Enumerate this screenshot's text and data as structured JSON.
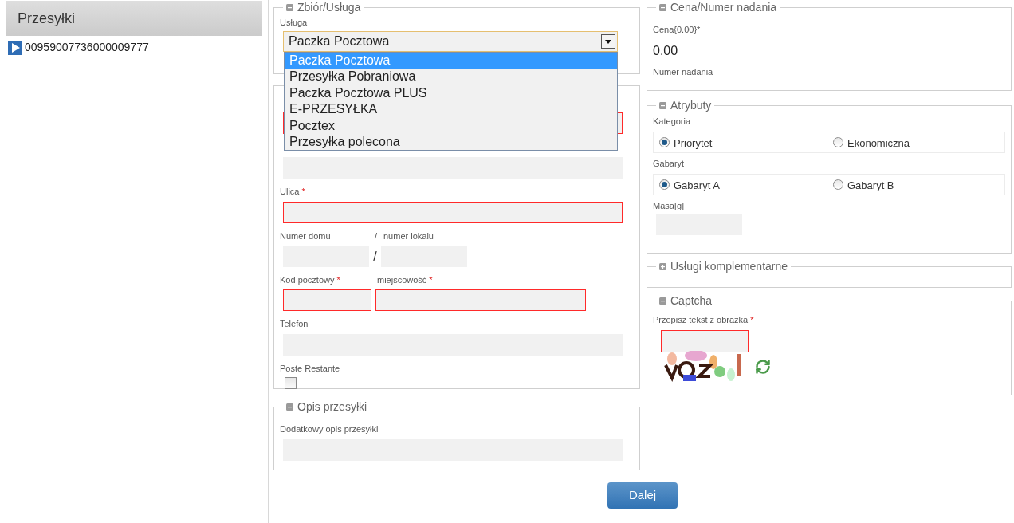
{
  "sidebar": {
    "title": "Przesyłki",
    "items": [
      {
        "label": "00959007736000009777"
      }
    ]
  },
  "service_section": {
    "title": "Zbiór/Usługa",
    "expanded": true,
    "label": "Usługa",
    "value": "Paczka Pocztowa",
    "open": true,
    "options": [
      {
        "label": "Paczka Pocztowa",
        "selected": true
      },
      {
        "label": "Przesyłka Pobraniowa",
        "selected": false
      },
      {
        "label": "Paczka Pocztowa PLUS",
        "selected": false
      },
      {
        "label": "E-PRZESYŁKA",
        "selected": false
      },
      {
        "label": "Pocztex",
        "selected": false
      },
      {
        "label": "Przesyłka polecona",
        "selected": false
      }
    ]
  },
  "address_section": {
    "rows": [
      {
        "kind": "field",
        "invalid": true
      },
      {
        "kind": "field",
        "invalid": false
      },
      {
        "kind": "field",
        "label": "Ulica",
        "required_mark": "*",
        "invalid": true
      },
      {
        "kind": "house_number",
        "label": "Numer domu",
        "label_separator": "/",
        "field_separator": "/",
        "fields": [
          {
            "label": "numer lokalu",
            "invalid": false
          }
        ]
      },
      {
        "kind": "postal_city",
        "fields": [
          {
            "label": "Kod pocztowy",
            "required_mark": "*",
            "invalid": true
          },
          {
            "label": "miejscowość",
            "required_mark": "*",
            "invalid": true
          }
        ]
      },
      {
        "kind": "field",
        "label": "Telefon",
        "invalid": false
      },
      {
        "kind": "checkbox",
        "label": "Poste Restante",
        "checked": false
      }
    ]
  },
  "description_section": {
    "title": "Opis przesyłki",
    "expanded": true,
    "label": "Dodatkowy opis przesyłki"
  },
  "price_section": {
    "title": "Cena/Numer nadania",
    "expanded": true,
    "price_label": "Cena{0.00}*",
    "price": "0.00",
    "number_label": "Numer nadania"
  },
  "attributes_section": {
    "title": "Atrybuty",
    "expanded": true,
    "groups": [
      {
        "label": "Kategoria",
        "options": [
          {
            "label": "Priorytet",
            "selected": true
          },
          {
            "label": "Ekonomiczna",
            "selected": false
          }
        ]
      },
      {
        "label": "Gabaryt",
        "options": [
          {
            "label": "Gabaryt A",
            "selected": true
          },
          {
            "label": "Gabaryt B",
            "selected": false
          }
        ]
      }
    ],
    "mass_label": "Masa[g]"
  },
  "complementary_section": {
    "title": "Usługi komplementarne",
    "expanded": false
  },
  "captcha_section": {
    "title": "Captcha",
    "expanded": true,
    "label": "Przepisz tekst z obrazka",
    "required_mark": "*",
    "invalid": true
  },
  "next_button": "Dalej"
}
